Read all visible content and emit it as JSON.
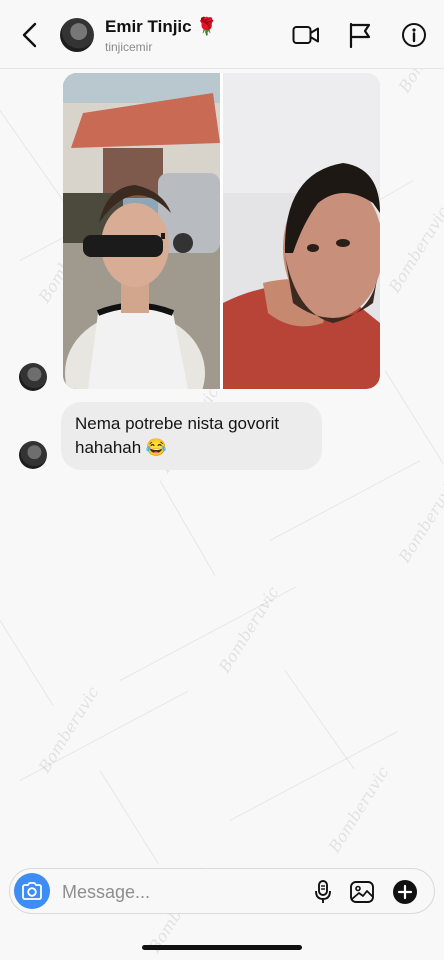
{
  "header": {
    "name": "Emir Tinjic 🌹",
    "username": "tinjicemir",
    "icons": [
      "back-icon",
      "video-call-icon",
      "flag-icon",
      "info-icon"
    ]
  },
  "thread": {
    "attachments": [
      "photo-left",
      "photo-right"
    ],
    "message": {
      "line1": "Nema potrebe nista govorit",
      "line2": "hahahah 😂"
    },
    "watermark": "Bomberuvic"
  },
  "composer": {
    "placeholder": "Message...",
    "icons": [
      "camera-icon",
      "microphone-icon",
      "image-icon",
      "add-icon"
    ]
  },
  "colors": {
    "accent": "#3d8df5",
    "bubble": "#ececec",
    "background": "#f8f8f8"
  }
}
